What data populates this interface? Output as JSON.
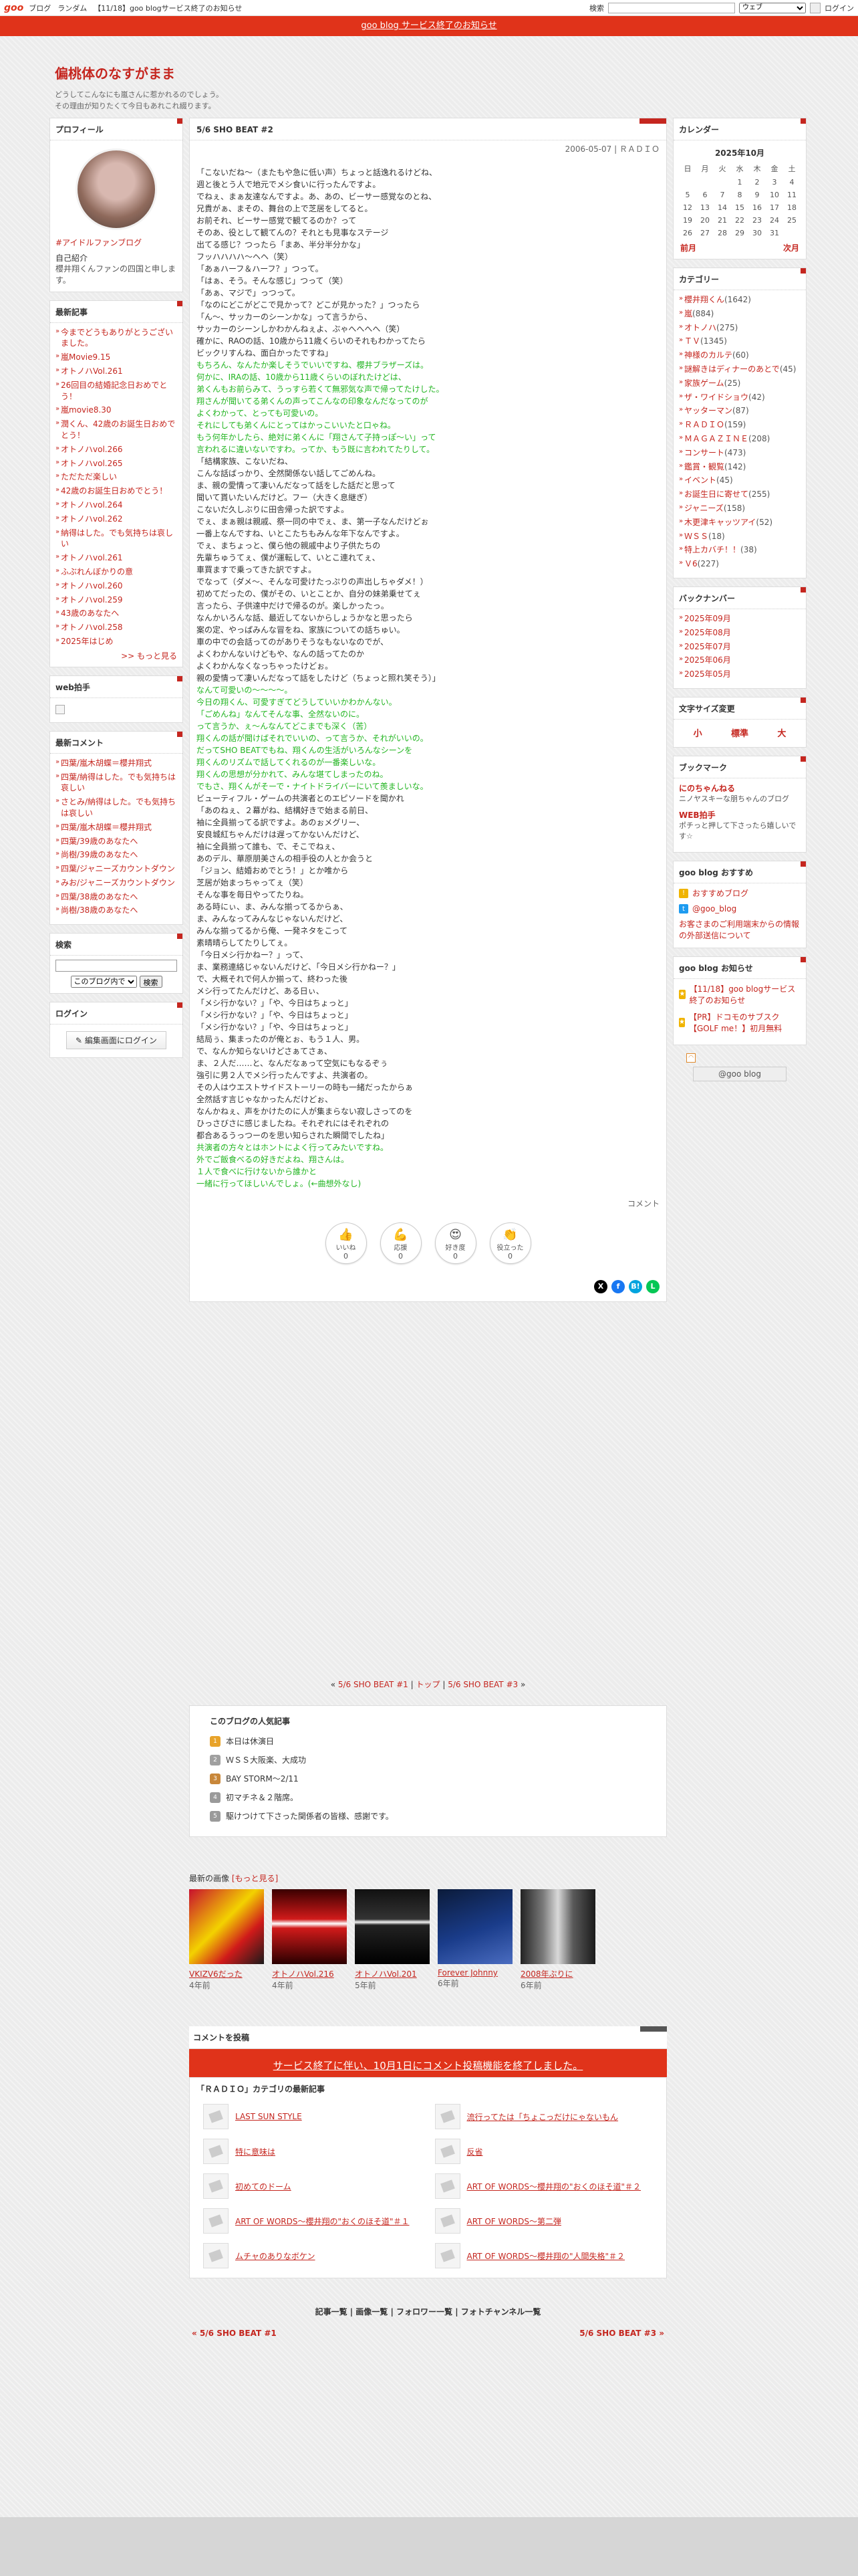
{
  "topbar": {
    "logo": "goo",
    "links": [
      "ブログ",
      "ランダム",
      "【11/18】goo blogサービス終了のお知らせ"
    ],
    "search_label": "検索",
    "search_scope": "ウェブ",
    "login": "ログイン"
  },
  "notice": "goo blog サービス終了のお知らせ",
  "blog": {
    "title": "偏桃体のなすがまま",
    "desc_lines": [
      "どうしてこんなにも嵐さんに惹かれるのでしょう。",
      "その理由が知りたくて今日もあれこれ綴ります。"
    ]
  },
  "profile": {
    "title": "プロフィール",
    "name": "#アイドルファンブログ",
    "label": "自己紹介",
    "text": "櫻井翔くんファンの四国と申します。"
  },
  "recent_posts": {
    "title": "最新記事",
    "items": [
      "今までどうもありがとうございました。",
      "嵐Movie9.15",
      "オトノハVol.261",
      "26回目の結婚記念日おめでとう！",
      "嵐movie8.30",
      "潤くん、42歳のお誕生日おめでとう！",
      "オトノハvol.266",
      "オトノハvol.265",
      "ただただ楽しい",
      "42歳のお誕生日おめでとう！",
      "オトノハvol.264",
      "オトノハvol.262",
      "納得はした。でも気持ちは哀しい",
      "オトノハvol.261",
      "ふぶれんぼかりの意",
      "オトノハvol.260",
      "オトノハvol.259",
      "43歳のあなたへ",
      "オトノハvol.258",
      "2025年はじめ"
    ],
    "more": ">> もっと見る"
  },
  "web_clap": {
    "title": "web拍手"
  },
  "recent_comments": {
    "title": "最新コメント",
    "items": [
      "四葉/嵐木胡蝶＝櫻井翔式",
      "四葉/納得はした。でも気持ちは哀しい",
      "さとみ/納得はした。でも気持ちは哀しい",
      "四葉/嵐木胡蝶＝櫻井翔式",
      "四葉/39歳のあなたへ",
      "尚樹/39歳のあなたへ",
      "四葉/ジャニーズカウントダウン",
      "みお/ジャニーズカウントダウン",
      "四葉/38歳のあなたへ",
      "尚樹/38歳のあなたへ"
    ]
  },
  "search": {
    "title": "検索",
    "scope": "このブログ内で",
    "button": "検索"
  },
  "login": {
    "title": "ログイン",
    "button": "編集画面にログイン"
  },
  "article": {
    "title": "5/6 SHO BEAT #2",
    "date": "2006-05-07 | ＲＡＤＩＯ",
    "lines": [
      {
        "t": "「こないだね～（またもや急に低い声）ちょっと話逸れるけどね、",
        "g": false
      },
      {
        "t": "週と後とう人で地元でメシ食いに行ったんですよ。",
        "g": false
      },
      {
        "t": "でねぇ、まぁ友達なんですよ。あ、あの、ビーサー感覚なのとね、",
        "g": false
      },
      {
        "t": "兄貴がぁ、まその、舞台の上で芝居をしてると。",
        "g": false
      },
      {
        "t": "お前それ、ビーサー感覚で観てるのか？って",
        "g": false
      },
      {
        "t": "そのあ、役として観てんの？それとも見事なステージ",
        "g": false
      },
      {
        "t": "出てる感じ？つったら「まあ、半分半分かな」",
        "g": false
      },
      {
        "t": "フッハハハハ～ヘヘ（笑）",
        "g": false
      },
      {
        "t": "「あぁハーフ＆ハーフ？」つって。",
        "g": false
      },
      {
        "t": "「はぁ、そう。そんな感じ」つって（笑）",
        "g": false
      },
      {
        "t": "「あぁ、マジで」っつって。",
        "g": false
      },
      {
        "t": "「なのにどこがどこで見かって？どこが見かった？」つったら",
        "g": false
      },
      {
        "t": "「ん～、サッカーのシーンかな」って言うから、",
        "g": false
      },
      {
        "t": "サッカーのシーンしかわかんねぇよ、ぶゃへへへへ（笑）",
        "g": false
      },
      {
        "t": "確かに、RAOの話、10歳から11歳くらいのそれもわかってたら",
        "g": false
      },
      {
        "t": "ビックリすんね、面白かったですね」",
        "g": false
      },
      {
        "t": "もちろん、なんたか楽しそうでいいですね、櫻井ブラザーズは。",
        "g": true
      },
      {
        "t": "何かに、IRAの話、10歳から11歳くらいのぼれたけどは、",
        "g": true
      },
      {
        "t": "弟くんもお前らみて、うっすら若くて無邪気な声で帰ってたけした。",
        "g": true
      },
      {
        "t": "翔さんが聞いてる弟くんの声ってこんなの印象なんだなってのが",
        "g": true
      },
      {
        "t": "よくわかって、とっても可愛いの。",
        "g": true
      },
      {
        "t": "それにしても弟くんにとってはかっこいいたと口ゃね。",
        "g": true
      },
      {
        "t": "もう何年かしたら、絶対に弟くんに「翔さんて子持っぽ～い」って",
        "g": true
      },
      {
        "t": "言われるに違いないですわ。ってか、もう既に言われてたりして。",
        "g": true
      },
      {
        "t": "「結構家族、こないだね、",
        "g": false
      },
      {
        "t": "こんな話ばっかり、全然関係ない話してごめんね。",
        "g": false
      },
      {
        "t": "ま、親の愛情って凄いんだなって話をした話だと思って",
        "g": false
      },
      {
        "t": "聞いて貰いたいんだけど。フー（大きく息継ぎ）",
        "g": false
      },
      {
        "t": "こないだ久しぶりに田舎帰った訳ですよ。",
        "g": false
      },
      {
        "t": "でぇ、まぁ親は親戚、祭一同の中でぇ、ま、第一子なんだけどぉ",
        "g": false
      },
      {
        "t": "一番上なんですね、いとこたちもみんな年下なんですよ。",
        "g": false
      },
      {
        "t": "でぇ、まちょっと、僕ら他の親戚中より子供たちの",
        "g": false
      },
      {
        "t": "先輩ちゅうてぇ、僕が運転して、いとこ連れてぇ、",
        "g": false
      },
      {
        "t": "車買ますで乗ってきた訳ですよ。",
        "g": false
      },
      {
        "t": "でなって（ダメ～、そんな可愛けたっぷりの声出しちゃダメ！）",
        "g": false
      },
      {
        "t": "初めてだったの、僕がその、いとことか、自分の妹弟乗せてぇ",
        "g": false
      },
      {
        "t": "言ったら、子供達中だけで帰るのが。楽しかったっ。",
        "g": false
      },
      {
        "t": "なんかいろんな話、最近してないからしょうかなと思ったら",
        "g": false
      },
      {
        "t": "案の定、やっぱみんな冒をね、家族についての話ちゅい。",
        "g": false
      },
      {
        "t": "車の中での会話ってのがありそうなもないなのでが、",
        "g": false
      },
      {
        "t": "よくわかんないけどもや、なんの話ってたのか",
        "g": false
      },
      {
        "t": "よくわかんなくなっちゃったけどぉ。",
        "g": false
      },
      {
        "t": "親の愛情って凄いんだなって話をしたけど（ちょっと照れ笑そう）」",
        "g": false
      },
      {
        "t": "なんて可愛いの～～～～。",
        "g": true
      },
      {
        "t": "今日の翔くん、可愛すぎてどうしていいかわかんない。",
        "g": true
      },
      {
        "t": "「ごめんね」なんてそんな事、全然ないのに。",
        "g": true
      },
      {
        "t": "って言うか、ぇ～んなんてどこまでも深く（苦）",
        "g": true
      },
      {
        "t": "翔くんの話が聞けばそれでいいの、って言うか、それがいいの。",
        "g": true
      },
      {
        "t": "だってSHO BEATでもね、翔くんの生活がいろんなシーンを",
        "g": true
      },
      {
        "t": "翔くんのリズムで話してくれるのが一番楽しいな。",
        "g": true
      },
      {
        "t": "翔くんの思想が分かれて、みんな堪てしまったのね。",
        "g": true
      },
      {
        "t": "でもさ、翔くんがそーで・ナイトドライバーにいて羨ましいな。",
        "g": true
      },
      {
        "t": "ビューティフル・ゲームの共演者とのエピソードを聞かれ",
        "g": false
      },
      {
        "t": "「あのねぇ、２幕がね、結構好きで始まる前日、",
        "g": false
      },
      {
        "t": "袖に全員揃ってる訳ですよ。あのぉメグリー、",
        "g": false
      },
      {
        "t": "安良城紅ちゃんだけは遅ってかないんだけど、",
        "g": false
      },
      {
        "t": "袖に全員揃って誰も、で、そこでねぇ、",
        "g": false
      },
      {
        "t": "あのデル、華原朋美さんの相手役の人とか会うと",
        "g": false
      },
      {
        "t": "「ジョン、結婚おめでとう！」とか唯から",
        "g": false
      },
      {
        "t": "芝居が始まっちゃってぇ（笑）",
        "g": false
      },
      {
        "t": "そんな事を毎日やってたりね。",
        "g": false
      },
      {
        "t": "ある時にぃ、ま、みんな揃ってるからぁ、",
        "g": false
      },
      {
        "t": "ま、みんなってみんなじゃないんだけど、",
        "g": false
      },
      {
        "t": "みんな揃ってるから俺、一発ネタをこって",
        "g": false
      },
      {
        "t": "素晴晴らしてたりしてぇ。",
        "g": false
      },
      {
        "t": "「今日メシ行かねー？」って、",
        "g": false
      },
      {
        "t": "ま、業務連絡じゃないんだけど、「今日メシ行かねー？」",
        "g": false
      },
      {
        "t": "で、大概それで何人か揃って、終わった後",
        "g": false
      },
      {
        "t": "メシ行ってたんだけど、ある日ぃ、",
        "g": false
      },
      {
        "t": "「メシ行かない？」「や、今日はちょっと」",
        "g": false
      },
      {
        "t": "「メシ行かない？」「や、今日はちょっと」",
        "g": false
      },
      {
        "t": "「メシ行かない？」「や、今日はちょっと」",
        "g": false
      },
      {
        "t": "結局ぅ、集まったのが俺とぉ、もう１人、男。",
        "g": false
      },
      {
        "t": "で、なんか知らないけどさぁてさぁ、",
        "g": false
      },
      {
        "t": "ま、２人だ……と、なんだなぁって空気にもなるぞぅ",
        "g": false
      },
      {
        "t": "強引に男２人でメシ行ったんですよ、共演者の。",
        "g": false
      },
      {
        "t": "その人はウエストサイドストーリーの時も一緒だったからぁ",
        "g": false
      },
      {
        "t": "全然話す言じゃなかったんだけどぉ、",
        "g": false
      },
      {
        "t": "なんかねぇ、声をかけたのに人が集まらない寂しさってのを",
        "g": false
      },
      {
        "t": "ひっさびさに感じましたね。それぞれにはそれぞれの",
        "g": false
      },
      {
        "t": "都合あるうっつーのを思い知らされた瞬間でしたね」",
        "g": false
      },
      {
        "t": "共演者の方々とはホントによく行ってみたいですね。",
        "g": true
      },
      {
        "t": "外でご飯食べるの好きだよね、翔さんは。",
        "g": true
      },
      {
        "t": "１人で食べに行けないから誰かと",
        "g": true
      },
      {
        "t": "一緒に行ってほしいんでしょ。(←曲想外なし)",
        "g": true
      }
    ],
    "comment_link": "コメント",
    "reactions": [
      {
        "emoji": "👍",
        "label": "いいね",
        "count": "0"
      },
      {
        "emoji": "💪",
        "label": "応援",
        "count": "0"
      },
      {
        "emoji": "😍",
        "label": "好き度",
        "count": "0"
      },
      {
        "emoji": "👏",
        "label": "役立った",
        "count": "0"
      }
    ]
  },
  "pager": {
    "prev": "5/6 SHO BEAT #1",
    "top": "トップ",
    "next": "5/6 SHO BEAT #3"
  },
  "popular": {
    "title": "このブログの人気記事",
    "items": [
      {
        "text": "本日は休演日",
        "color": "#e8a32a"
      },
      {
        "text": "ＷＳＳ大阪楽、大成功",
        "color": "#a0a0a0"
      },
      {
        "text": "BAY STORM～2/11",
        "color": "#c8873a"
      },
      {
        "text": "初マチネ＆２階席。",
        "color": "#9a9a9a"
      },
      {
        "text": "駆けつけて下さった関係者の皆様、感謝です。",
        "color": "#9a9a9a"
      }
    ]
  },
  "recent_images": {
    "title": "最新の画像",
    "more": "[もっと見る]",
    "items": [
      {
        "caption": "VKIZV6だった",
        "age": "4年前"
      },
      {
        "caption": "オトノハVol.216",
        "age": "4年前"
      },
      {
        "caption": "オトノハVol.201",
        "age": "5年前"
      },
      {
        "caption": "Forever Johnny",
        "age": "6年前"
      },
      {
        "caption": "2008年ぶりに",
        "age": "6年前"
      }
    ]
  },
  "post_comment": {
    "title": "コメントを投稿",
    "notice": "サービス終了に伴い、10月1日にコメント投稿機能を終了しました。"
  },
  "category_latest": {
    "title": "「ＲＡＤＩＯ」カテゴリの最新記事",
    "items": [
      "LAST SUN STYLE",
      "流行ってたは「ちょこっだけにゃないもん",
      "特に意味は",
      "反省",
      "初めてのドーム",
      "ART OF WORDS～櫻井翔の\"おくのほそ道\"＃２",
      "ART OF WORDS～櫻井翔の\"おくのほそ道\"＃１",
      "ART OF WORDS～第二弾",
      "ムチャのありなボケン",
      "ART OF WORDS～櫻井翔の\"人間失格\"＃２"
    ]
  },
  "footer": {
    "links": "記事一覧 | 画像一覧 | フォロワー一覧 | フォトチャンネル一覧",
    "prev": "« 5/6 SHO BEAT #1",
    "next": "5/6 SHO BEAT #3 »"
  },
  "calendar": {
    "title": "カレンダー",
    "month": "2025年10月",
    "weekdays": [
      "日",
      "月",
      "火",
      "水",
      "木",
      "金",
      "土"
    ],
    "weeks": [
      [
        "",
        "",
        "",
        "1",
        "2",
        "3",
        "4"
      ],
      [
        "5",
        "6",
        "7",
        "8",
        "9",
        "10",
        "11"
      ],
      [
        "12",
        "13",
        "14",
        "15",
        "16",
        "17",
        "18"
      ],
      [
        "19",
        "20",
        "21",
        "22",
        "23",
        "24",
        "25"
      ],
      [
        "26",
        "27",
        "28",
        "29",
        "30",
        "31",
        ""
      ]
    ],
    "prev": "前月",
    "next": "次月"
  },
  "categories": {
    "title": "カテゴリー",
    "items": [
      {
        "name": "櫻井翔くん",
        "count": "(1642)"
      },
      {
        "name": "嵐",
        "count": "(884)"
      },
      {
        "name": "オトノハ",
        "count": "(275)"
      },
      {
        "name": "ＴＶ",
        "count": "(1345)"
      },
      {
        "name": "神様のカルテ",
        "count": "(60)"
      },
      {
        "name": "謎解きはディナーのあとで",
        "count": "(45)"
      },
      {
        "name": "家族ゲーム",
        "count": "(25)"
      },
      {
        "name": "ザ・ワイドショウ",
        "count": "(42)"
      },
      {
        "name": "ヤッターマン",
        "count": "(87)"
      },
      {
        "name": "ＲＡＤＩＯ",
        "count": "(159)"
      },
      {
        "name": "ＭＡＧＡＺＩＮＥ",
        "count": "(208)"
      },
      {
        "name": "コンサート",
        "count": "(473)"
      },
      {
        "name": "鑑賞・観覧",
        "count": "(142)"
      },
      {
        "name": "イベント",
        "count": "(45)"
      },
      {
        "name": "お誕生日に寄せて",
        "count": "(255)"
      },
      {
        "name": "ジャニーズ",
        "count": "(158)"
      },
      {
        "name": "木更津キャッツアイ",
        "count": "(52)"
      },
      {
        "name": "ＷＳＳ",
        "count": "(18)"
      },
      {
        "name": "特上カバチ！！",
        "count": "(38)"
      },
      {
        "name": "Ｖ6",
        "count": "(227)"
      }
    ]
  },
  "backnumber": {
    "title": "バックナンバー",
    "items": [
      "2025年09月",
      "2025年08月",
      "2025年07月",
      "2025年06月",
      "2025年05月"
    ]
  },
  "fontsize": {
    "title": "文字サイズ変更",
    "small": "小",
    "mid": "標準",
    "large": "大"
  },
  "bookmarks": {
    "title": "ブックマーク",
    "items": [
      {
        "name": "にのちゃんねる",
        "desc": "ニノヤスキーな朋ちゃんのブログ"
      },
      {
        "name": "WEB拍手",
        "desc": "ポチっと押して下さったら嬉しいです☆"
      }
    ]
  },
  "goo_recommend": {
    "title": "goo blog おすすめ",
    "items": [
      {
        "text": "おすすめブログ",
        "color": "#f0b400"
      },
      {
        "text": "@goo_blog",
        "color": "#1d9bf0"
      }
    ],
    "lines": [
      "お客さまのご利用端末からの情報の外部送信について"
    ]
  },
  "goo_news": {
    "title": "goo blog お知らせ",
    "items": [
      "【11/18】goo blogサービス終了のお知らせ",
      "【PR】ドコモのサブスク【GOLF me！】初月無料"
    ],
    "badge": "@goo blog"
  },
  "colors": {
    "accent": "#c5261f",
    "notice_red": "#e0331a",
    "green_text": "#22b521"
  }
}
